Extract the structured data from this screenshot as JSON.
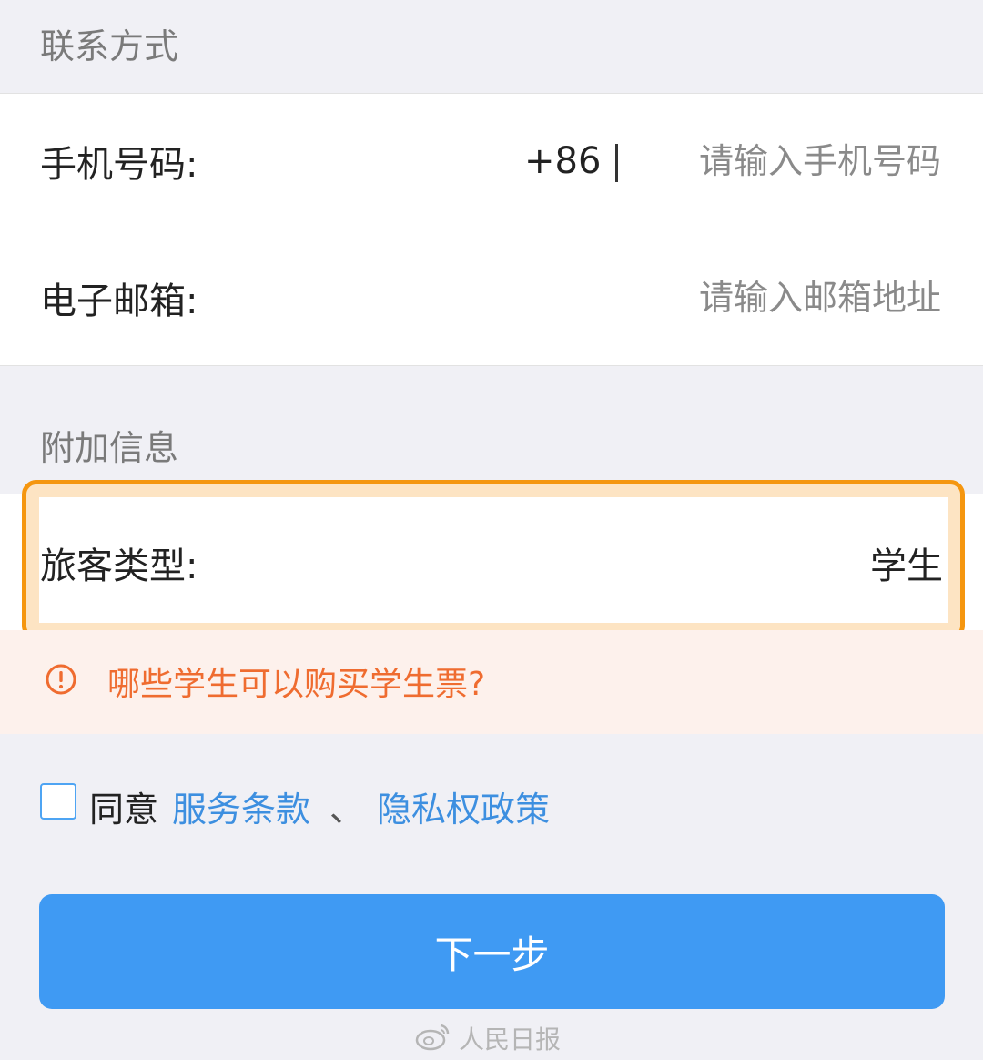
{
  "sections": {
    "contact_header": "联系方式",
    "extra_header": "附加信息"
  },
  "phone": {
    "label": "手机号码:",
    "country_code": "+86",
    "placeholder": "请输入手机号码"
  },
  "email": {
    "label": "电子邮箱:",
    "placeholder": "请输入邮箱地址"
  },
  "passenger_type": {
    "label": "旅客类型:",
    "value": "学生"
  },
  "notice": {
    "icon": "warning-circle-icon",
    "text": "哪些学生可以购买学生票?",
    "color": "#ef6c30"
  },
  "agreement": {
    "prefix": "同意",
    "terms_link": "服务条款",
    "separator": "、",
    "privacy_link": "隐私权政策",
    "checked": false
  },
  "next_button": {
    "label": "下一步",
    "color": "#3f9af3"
  },
  "highlight": {
    "color": "#f5960f"
  },
  "watermark": {
    "icon": "weibo-logo-icon",
    "text": "人民日报"
  }
}
